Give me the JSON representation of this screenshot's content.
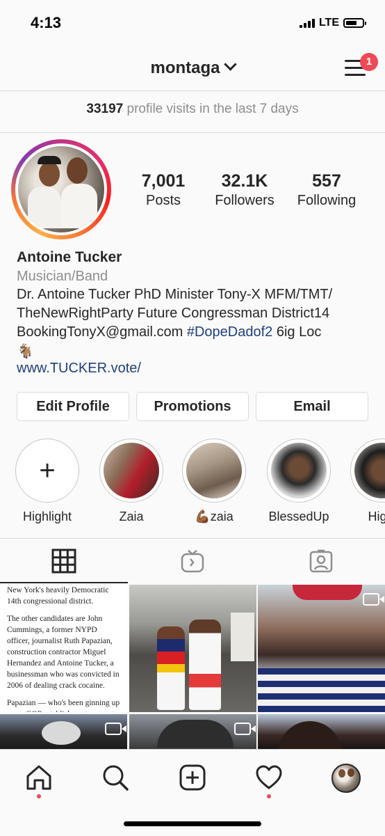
{
  "status_bar": {
    "time": "4:13",
    "network": "LTE",
    "battery_level": 0.7
  },
  "header": {
    "username": "montaga",
    "menu_badge": "1",
    "icons": [
      "chevron-down-icon",
      "menu-icon"
    ]
  },
  "visits": {
    "count": "33197",
    "text": "profile visits in the last 7 days"
  },
  "stats": [
    {
      "value": "7,001",
      "label": "Posts"
    },
    {
      "value": "32.1K",
      "label": "Followers"
    },
    {
      "value": "557",
      "label": "Following"
    }
  ],
  "bio": {
    "name": "Antoine Tucker",
    "category": "Musician/Band",
    "line1": "Dr. Antoine Tucker PhD Minister Tony-X MFM/TMT/",
    "line2": "TheNewRightParty Future Congressman District14",
    "line3_prefix": "BookingTonyX@gmail.com ",
    "hashtag": "#DopeDadof2",
    "line3_suffix": " 6ig Loc",
    "emoji": "🐐",
    "link": "www.TUCKER.vote/"
  },
  "buttons": {
    "edit": "Edit Profile",
    "promotions": "Promotions",
    "email": "Email"
  },
  "highlights": [
    {
      "label": "Highlight",
      "icon": "plus-icon"
    },
    {
      "label": "Zaia"
    },
    {
      "label": "💪🏾zaia"
    },
    {
      "label": "BlessedUp"
    },
    {
      "label": "Highl"
    }
  ],
  "tabs": [
    {
      "name": "grid",
      "icon": "grid-icon",
      "active": true
    },
    {
      "name": "igtv",
      "icon": "igtv-icon",
      "active": false
    },
    {
      "name": "tagged",
      "icon": "tagged-person-icon",
      "active": false
    }
  ],
  "article": {
    "p1": "New York's heavily Democratic 14th congressional district.",
    "p2": "The other candidates are John Cummings, a former NYPD officer, journalist Ruth Papazian, construction contractor Miguel Hernandez and Antoine Tucker, a businessman who was convicted in 2006 of dealing crack cocaine.",
    "p3": "Papazian — who's been ginning up some GOP establishment support and recently had a phone call with ex-Trump campaign manager Corey Lewandowski — pounced on Murray's announcement and claimed"
  },
  "bottom_nav": [
    {
      "name": "home",
      "icon": "home-icon",
      "notification_dot": true
    },
    {
      "name": "search",
      "icon": "search-icon",
      "notification_dot": false
    },
    {
      "name": "new-post",
      "icon": "plus-square-icon",
      "notification_dot": false
    },
    {
      "name": "activity",
      "icon": "heart-icon",
      "notification_dot": true
    },
    {
      "name": "profile",
      "icon": "avatar",
      "notification_dot": false
    }
  ],
  "colors": {
    "link": "#1f3f7a",
    "badge": "#ed4956",
    "muted": "#8e8e8e"
  }
}
